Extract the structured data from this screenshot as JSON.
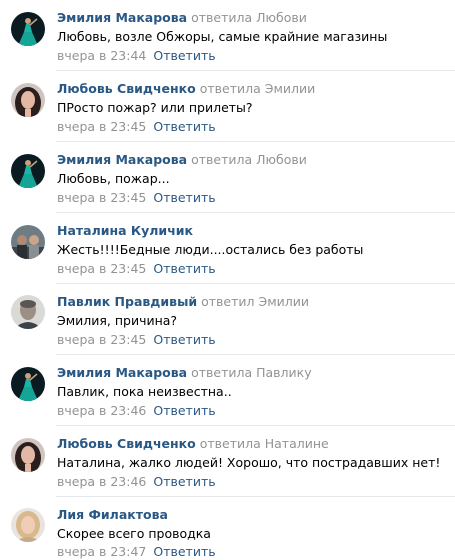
{
  "actions": {
    "reply_label": "Ответить"
  },
  "comments": [
    {
      "author": "Эмилия Макарова",
      "reply_to": "ответила Любови",
      "text": "Любовь, возле Обжоры, самые крайние магазины",
      "time": "вчера в 23:44",
      "avatar": "dancer-avatar"
    },
    {
      "author": "Любовь Свидченко",
      "reply_to": "ответила Эмилии",
      "text": "ПРосто пожар? или прилеты?",
      "time": "вчера в 23:45",
      "avatar": "woman-portrait-avatar"
    },
    {
      "author": "Эмилия Макарова",
      "reply_to": "ответила Любови",
      "text": "Любовь, пожар...",
      "time": "вчера в 23:45",
      "avatar": "dancer-avatar"
    },
    {
      "author": "Наталина Куличик",
      "reply_to": "",
      "text": "Жесть!!!!Бедные люди....остались без работы",
      "time": "вчера в 23:45",
      "avatar": "group-photo-avatar"
    },
    {
      "author": "Павлик Правдивый",
      "reply_to": "ответил Эмилии",
      "text": "Эмилия, причина?",
      "time": "вчера в 23:45",
      "avatar": "man-portrait-avatar"
    },
    {
      "author": "Эмилия Макарова",
      "reply_to": "ответила Павлику",
      "text": "Павлик, пока неизвестна..",
      "time": "вчера в 23:46",
      "avatar": "dancer-avatar"
    },
    {
      "author": "Любовь Свидченко",
      "reply_to": "ответила Наталине",
      "text": "Наталина, жалко людей! Хорошо, что пострадавших нет!",
      "time": "вчера в 23:46",
      "avatar": "woman-portrait-avatar"
    },
    {
      "author": "Лия Филактова",
      "reply_to": "",
      "text": "Скорее всего проводка",
      "time": "вчера в 23:47",
      "avatar": "blonde-woman-avatar"
    }
  ]
}
